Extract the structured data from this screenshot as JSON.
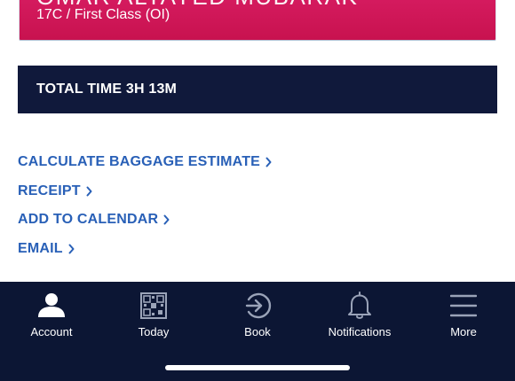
{
  "passenger": {
    "name": "OMAR ALTAYED MUBARAK",
    "seat_class": "17C / First Class (OI)"
  },
  "trip": {
    "total_time_label": "TOTAL TIME 3H 13M"
  },
  "links": [
    {
      "label": "CALCULATE BAGGAGE ESTIMATE"
    },
    {
      "label": "RECEIPT"
    },
    {
      "label": "ADD TO CALENDAR"
    },
    {
      "label": "EMAIL"
    }
  ],
  "tab_bar": {
    "tabs": [
      {
        "label": "Account",
        "icon": "person-icon",
        "active": true
      },
      {
        "label": "Today",
        "icon": "qr-code-icon",
        "active": false
      },
      {
        "label": "Book",
        "icon": "arrow-circle-icon",
        "active": false
      },
      {
        "label": "Notifications",
        "icon": "bell-icon",
        "active": false
      },
      {
        "label": "More",
        "icon": "hamburger-menu-icon",
        "active": false
      }
    ]
  },
  "colors": {
    "card_magenta": "#cc1456",
    "navy": "#10193b",
    "tab_bar_bg": "#0c1634",
    "link_blue": "#2960b7",
    "active_icon": "#ffffff",
    "inactive_icon": "#9aa3b8"
  }
}
